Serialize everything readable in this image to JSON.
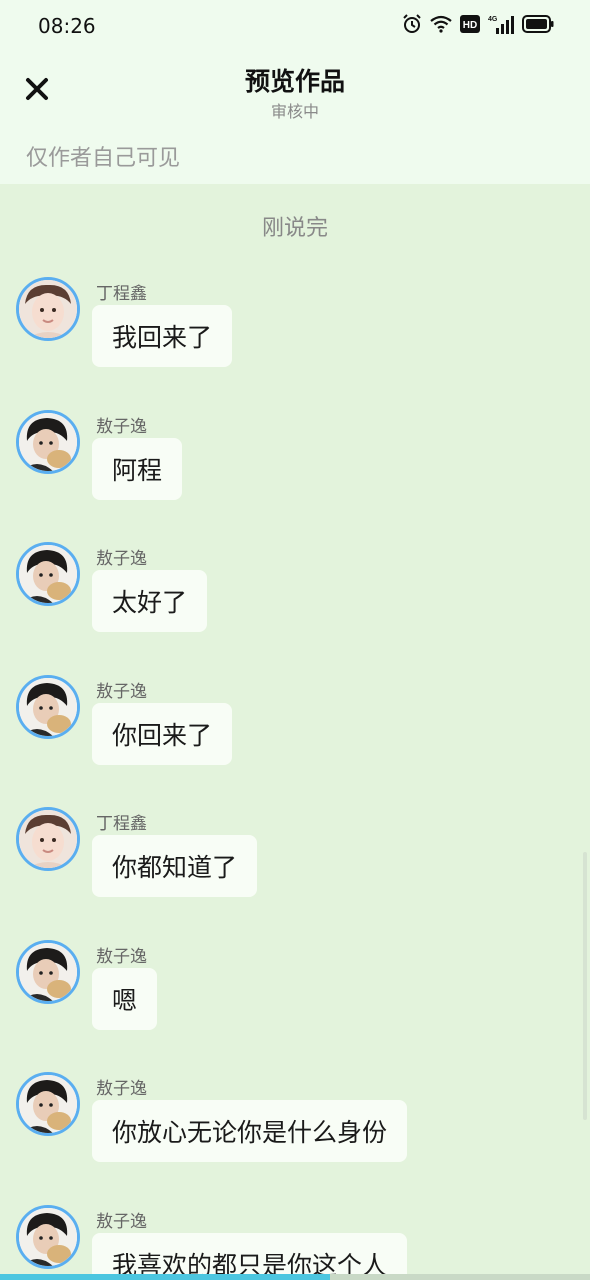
{
  "status_bar": {
    "time": "08:26",
    "icons": [
      "alarm-icon",
      "wifi-icon",
      "hd-icon",
      "4g-signal-icon",
      "battery-icon"
    ],
    "hd_label": "HD",
    "network_label": "4G"
  },
  "header": {
    "title": "预览作品",
    "subtitle": "审核中",
    "visibility_note": "仅作者自己可见"
  },
  "chat": {
    "timestamp": "刚说完",
    "messages": [
      {
        "sender": "丁程鑫",
        "text": "我回来了",
        "avatar": "ding"
      },
      {
        "sender": "敖子逸",
        "text": "阿程",
        "avatar": "ao"
      },
      {
        "sender": "敖子逸",
        "text": "太好了",
        "avatar": "ao"
      },
      {
        "sender": "敖子逸",
        "text": "你回来了",
        "avatar": "ao"
      },
      {
        "sender": "丁程鑫",
        "text": "你都知道了",
        "avatar": "ding"
      },
      {
        "sender": "敖子逸",
        "text": "嗯",
        "avatar": "ao"
      },
      {
        "sender": "敖子逸",
        "text": "你放心无论你是什么身份",
        "avatar": "ao"
      },
      {
        "sender": "敖子逸",
        "text": "我喜欢的都只是你这个人",
        "avatar": "ao"
      }
    ]
  },
  "progress": 0.56,
  "colors": {
    "accent": "#5aaef0",
    "chat_background": "#e3f3dc",
    "header_background": "#effbee",
    "bubble": "#f8fdf6",
    "progress": "#4cc6e0"
  }
}
